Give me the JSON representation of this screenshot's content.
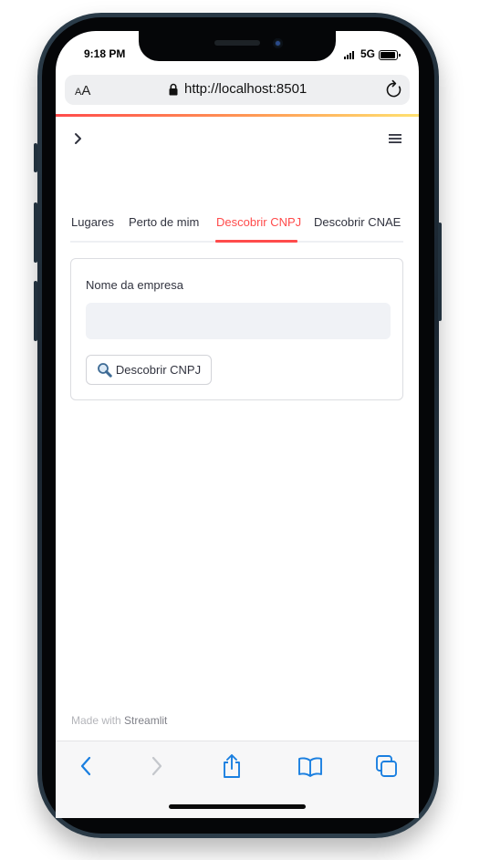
{
  "status_bar": {
    "time": "9:18 PM",
    "network": "5G"
  },
  "browser": {
    "text_size_label_small": "A",
    "text_size_label_large": "A",
    "url": "http://localhost:8501"
  },
  "tabs": [
    {
      "label": "Lugares",
      "active": false
    },
    {
      "label": "Perto de mim",
      "active": false
    },
    {
      "label": "Descobrir CNPJ",
      "active": true
    },
    {
      "label": "Descobrir CNAE",
      "active": false
    }
  ],
  "form": {
    "field_label": "Nome da empresa",
    "field_value": "",
    "submit_label": "Descobrir CNPJ",
    "submit_icon": "magnifying-glass-icon"
  },
  "footer": {
    "prefix": "Made with",
    "brand": "Streamlit"
  },
  "toolbar": {
    "icons": [
      "back-icon",
      "forward-icon",
      "share-icon",
      "bookmarks-icon",
      "tabs-icon"
    ]
  },
  "colors": {
    "accent": "#ff4b4b",
    "text": "#31333f",
    "input_bg": "#f0f2f6",
    "ios_blue": "#1a7fe0"
  }
}
